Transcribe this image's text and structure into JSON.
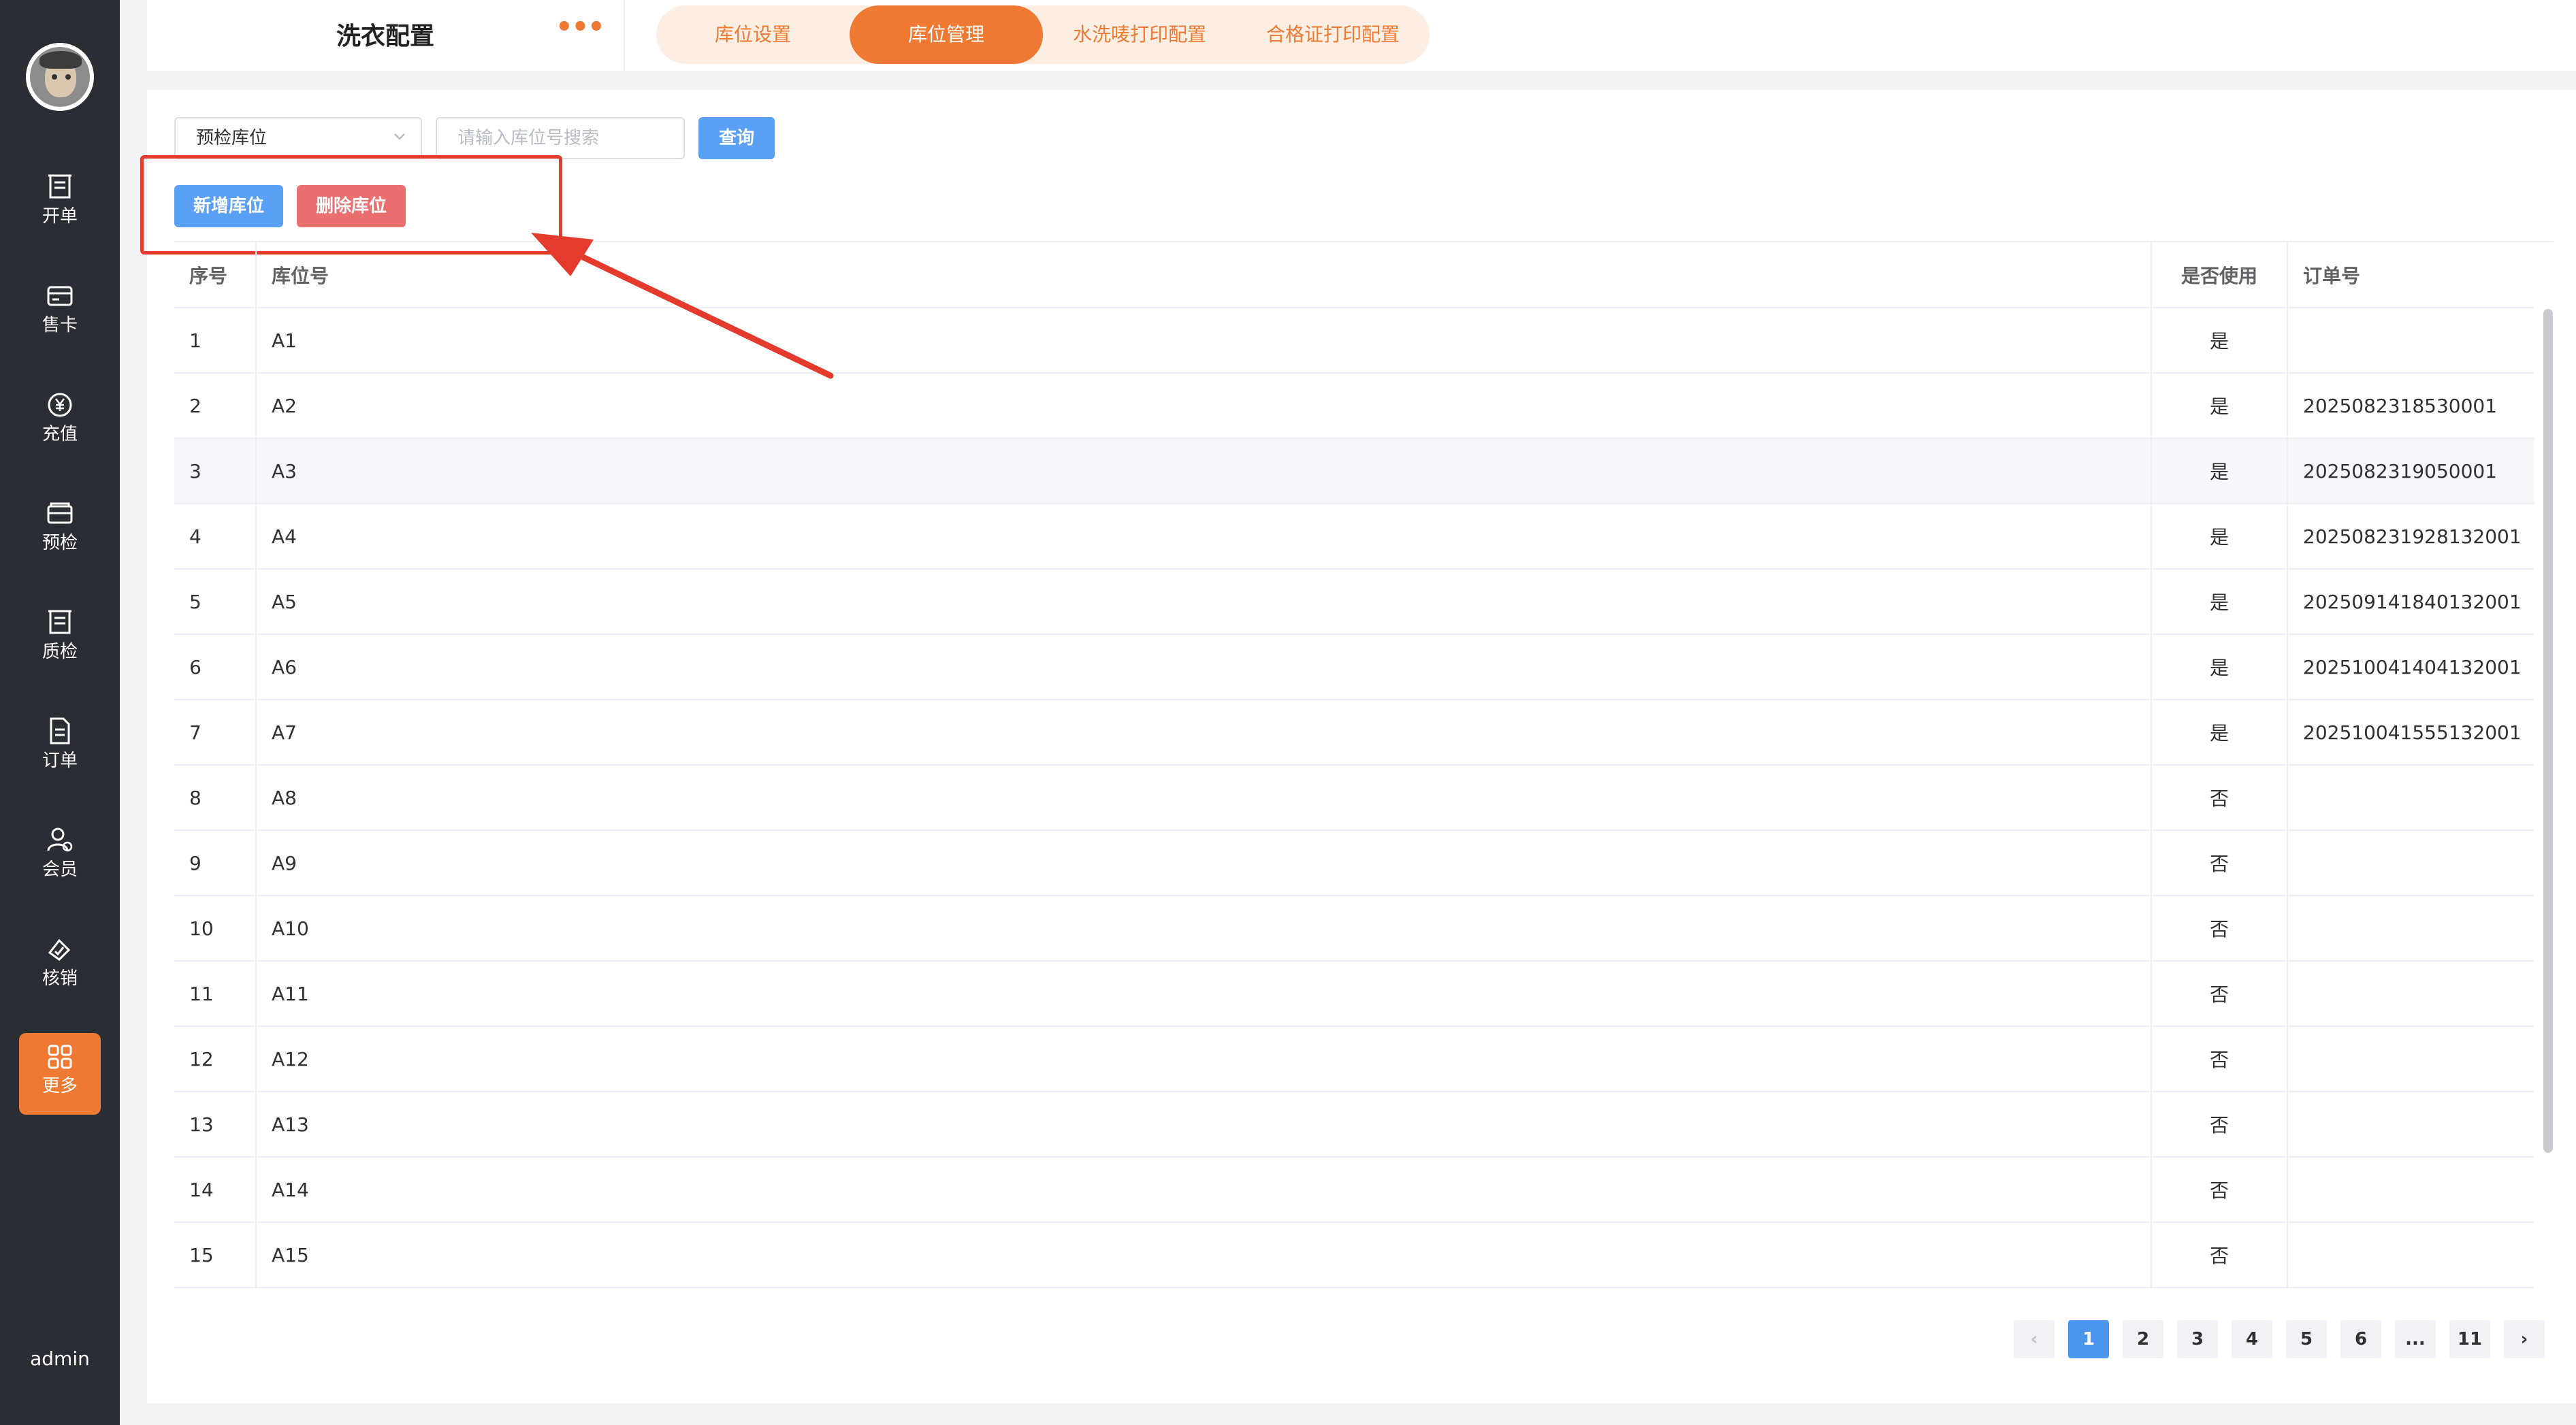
{
  "sidebar": {
    "items": [
      {
        "label": "开单",
        "icon": "receipt-icon"
      },
      {
        "label": "售卡",
        "icon": "card-icon"
      },
      {
        "label": "充值",
        "icon": "yen-coin-icon"
      },
      {
        "label": "预检",
        "icon": "wallet-icon"
      },
      {
        "label": "质检",
        "icon": "clipboard-icon"
      },
      {
        "label": "订单",
        "icon": "document-icon"
      },
      {
        "label": "会员",
        "icon": "member-icon"
      },
      {
        "label": "核销",
        "icon": "writeoff-icon"
      },
      {
        "label": "更多",
        "icon": "grid-icon"
      }
    ],
    "active_index": 8,
    "user": "admin"
  },
  "header": {
    "title": "洗衣配置",
    "more": "•••",
    "tabs": [
      "库位设置",
      "库位管理",
      "水洗唛打印配置",
      "合格证打印配置"
    ],
    "active_tab": 1
  },
  "filters": {
    "select_value": "预检库位",
    "search_placeholder": "请输入库位号搜索",
    "query_label": "查询"
  },
  "actions": {
    "add_label": "新增库位",
    "delete_label": "删除库位"
  },
  "table": {
    "columns": [
      "序号",
      "库位号",
      "是否使用",
      "订单号"
    ],
    "rows": [
      [
        "1",
        "A1",
        "是",
        ""
      ],
      [
        "2",
        "A2",
        "是",
        "2025082318530001"
      ],
      [
        "3",
        "A3",
        "是",
        "2025082319050001"
      ],
      [
        "4",
        "A4",
        "是",
        "202508231928132001"
      ],
      [
        "5",
        "A5",
        "是",
        "202509141840132001"
      ],
      [
        "6",
        "A6",
        "是",
        "202510041404132001"
      ],
      [
        "7",
        "A7",
        "是",
        "202510041555132001"
      ],
      [
        "8",
        "A8",
        "否",
        ""
      ],
      [
        "9",
        "A9",
        "否",
        ""
      ],
      [
        "10",
        "A10",
        "否",
        ""
      ],
      [
        "11",
        "A11",
        "否",
        ""
      ],
      [
        "12",
        "A12",
        "否",
        ""
      ],
      [
        "13",
        "A13",
        "否",
        ""
      ],
      [
        "14",
        "A14",
        "否",
        ""
      ],
      [
        "15",
        "A15",
        "否",
        ""
      ]
    ],
    "hover_row": 2
  },
  "pagination": {
    "pages": [
      "1",
      "2",
      "3",
      "4",
      "5",
      "6",
      "...",
      "11"
    ],
    "current": "1",
    "prev": "‹",
    "next": "›"
  },
  "colors": {
    "accent": "#ee7a33",
    "primary_button": "#5aa0f5",
    "danger_button": "#ea7070",
    "annotation": "#e53a2e",
    "sidebar_bg": "#2b2d35"
  }
}
